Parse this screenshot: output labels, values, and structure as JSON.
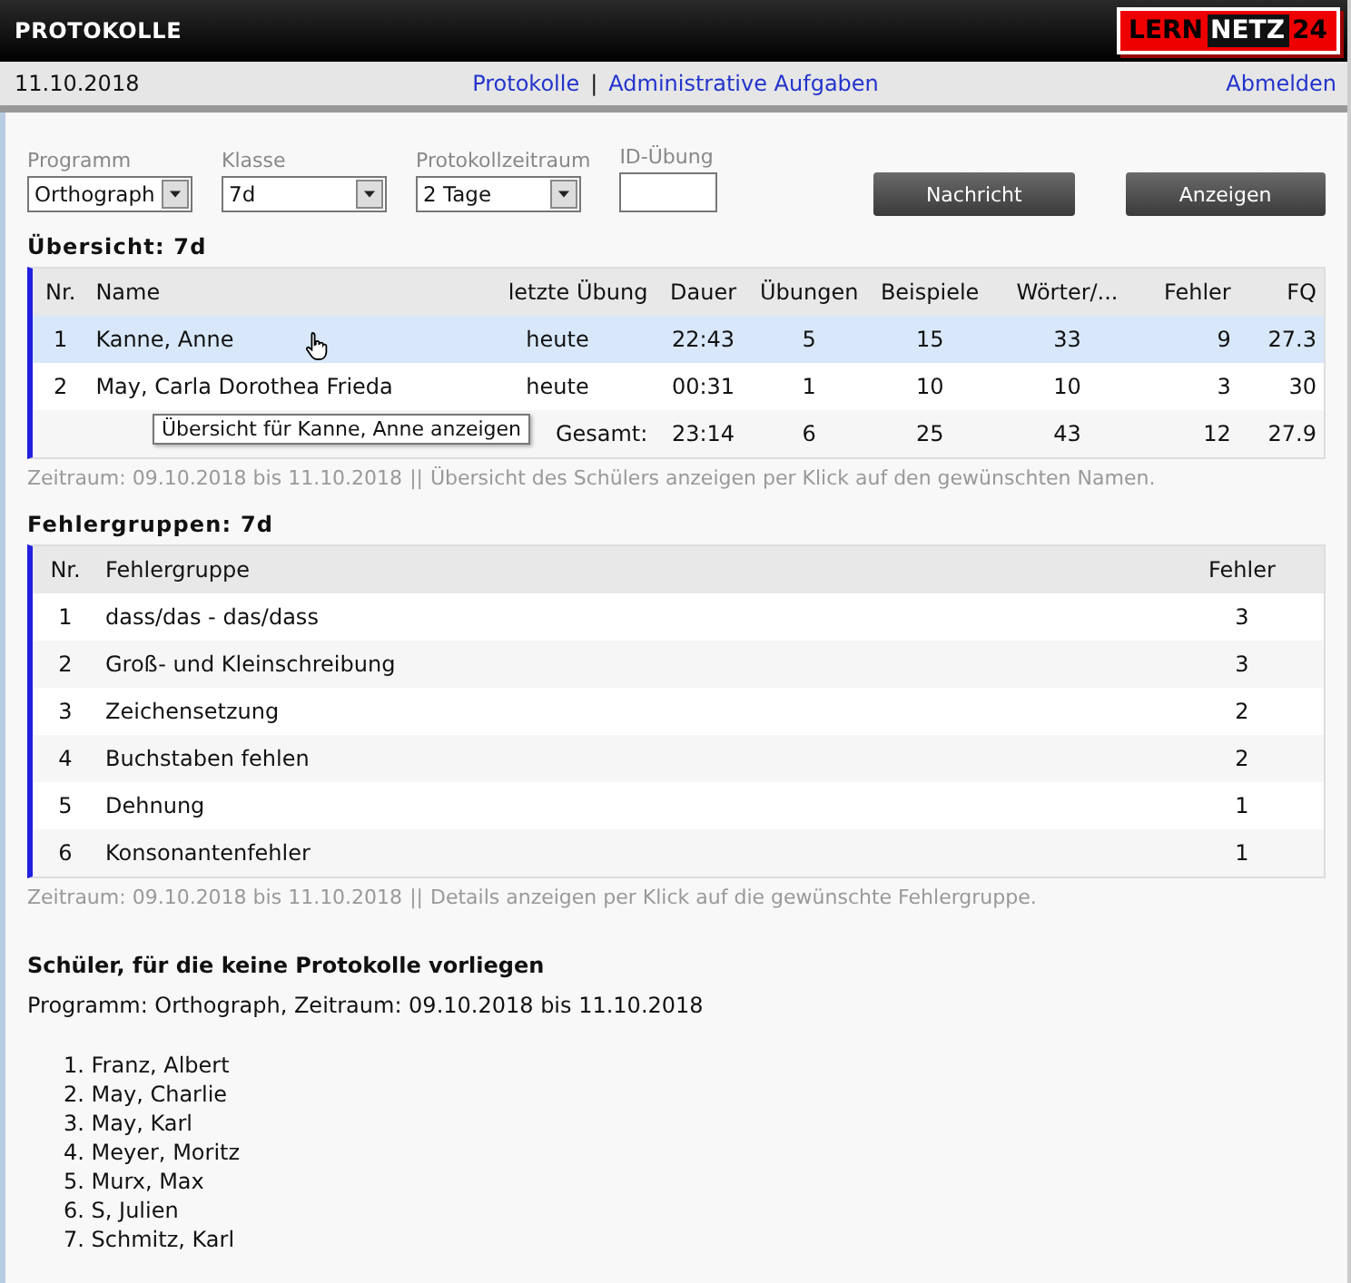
{
  "header": {
    "title": "PROTOKOLLE",
    "logo": {
      "part_1": "LERN",
      "part_2": "NETZ",
      "part_3": "24"
    }
  },
  "nav": {
    "date": "11.10.2018",
    "links": [
      {
        "label": "Protokolle"
      },
      {
        "label": "Administrative Aufgaben"
      }
    ],
    "separator": "|",
    "logout": "Abmelden"
  },
  "filters": [
    {
      "label": "Programm",
      "kind": "select",
      "value": "Orthograph"
    },
    {
      "label": "Klasse",
      "kind": "select",
      "value": "7d"
    },
    {
      "label": "Protokollzeitraum",
      "kind": "select",
      "value": "2 Tage"
    },
    {
      "label": "ID-Übung",
      "kind": "input"
    }
  ],
  "buttons": [
    "Nachricht",
    "Anzeigen"
  ],
  "overview": {
    "title": "Übersicht: 7d",
    "columns": [
      "Nr.",
      "Name",
      "letzte Übung",
      "Dauer",
      "Übungen",
      "Beispiele",
      "Wörter/...",
      "Fehler",
      "FQ"
    ],
    "rows": [
      {
        "cells": [
          "1",
          "Kanne, Anne",
          "heute",
          "22:43",
          "5",
          "15",
          "33",
          "9",
          "27.3"
        ],
        "selected": true
      },
      {
        "cells": [
          "2",
          "May, Carla Dorothea Frieda",
          "heute",
          "00:31",
          "1",
          "10",
          "10",
          "3",
          "30"
        ],
        "selected": false
      }
    ],
    "total": {
      "label": "Gesamt:",
      "cells": [
        "23:14",
        "6",
        "25",
        "43",
        "12",
        "27.9"
      ]
    },
    "tooltip": "Übersicht für Kanne, Anne anzeigen",
    "note": {
      "period": "Zeitraum: 09.10.2018 bis 11.10.2018",
      "separator": "||",
      "hint": "Übersicht des Schülers anzeigen per Klick auf den gewünschten Namen."
    }
  },
  "error_groups": {
    "title": "Fehlergruppen: 7d",
    "columns": [
      "Nr.",
      "Fehlergruppe",
      "Fehler"
    ],
    "rows": [
      [
        "1",
        "dass/das - das/dass",
        "3"
      ],
      [
        "2",
        "Groß- und Kleinschreibung",
        "3"
      ],
      [
        "3",
        "Zeichensetzung",
        "2"
      ],
      [
        "4",
        "Buchstaben fehlen",
        "2"
      ],
      [
        "5",
        "Dehnung",
        "1"
      ],
      [
        "6",
        "Konsonantenfehler",
        "1"
      ]
    ],
    "note": {
      "period": "Zeitraum: 09.10.2018 bis 11.10.2018",
      "separator": "||",
      "hint": "Details anzeigen per Klick auf die gewünschte Fehlergruppe."
    }
  },
  "missing": {
    "title": "Schüler, für die keine Protokolle vorliegen",
    "subtitle": "Programm: Orthograph, Zeitraum: 09.10.2018 bis 11.10.2018",
    "students": [
      {
        "marker": "1.",
        "name": "Franz, Albert"
      },
      {
        "marker": "2.",
        "name": "May, Charlie"
      },
      {
        "marker": "3.",
        "name": "May, Karl"
      },
      {
        "marker": "4.",
        "name": "Meyer, Moritz"
      },
      {
        "marker": "5.",
        "name": "Murx, Max"
      },
      {
        "marker": "6.",
        "name": "S, Julien"
      },
      {
        "marker": "7.",
        "name": "Schmitz, Karl"
      }
    ]
  }
}
